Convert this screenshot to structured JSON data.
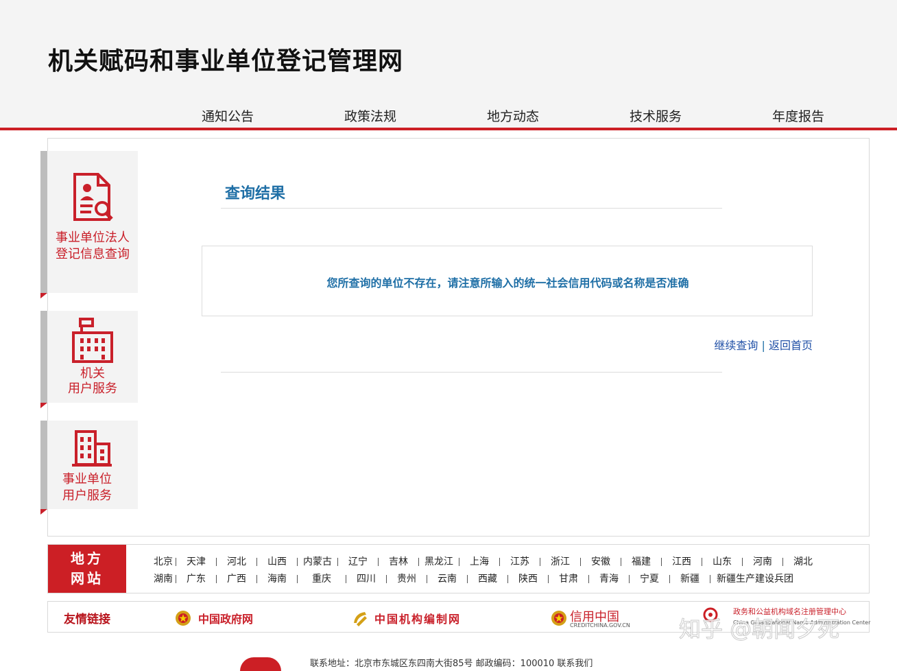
{
  "header": {
    "site_title": "机关赋码和事业单位登记管理网",
    "nav": [
      "通知公告",
      "政策法规",
      "地方动态",
      "技术服务",
      "年度报告"
    ]
  },
  "sidebar": {
    "items": [
      {
        "label_line1": "事业单位法人",
        "label_line2": "登记信息查询",
        "icon": "document-search-icon"
      },
      {
        "label_line1": "机关",
        "label_line2": "用户服务",
        "icon": "government-building-icon"
      },
      {
        "label_line1": "事业单位",
        "label_line2": "用户服务",
        "icon": "office-building-icon"
      }
    ]
  },
  "result": {
    "title": "查询结果",
    "message": "您所查询的单位不存在，请注意所输入的统一社会信用代码或名称是否准确",
    "continue_link": "继续查询",
    "divider": "|",
    "home_link": "返回首页"
  },
  "local_sites": {
    "title_line1": "地方",
    "title_line2": "网站",
    "row1": [
      "北京",
      "天津",
      "河北",
      "山西",
      "内蒙古",
      "辽宁",
      "吉林",
      "黑龙江",
      "上海",
      "江苏",
      "浙江",
      "安徽",
      "福建",
      "江西",
      "山东",
      "河南",
      "湖北"
    ],
    "row2": [
      "湖南",
      "广东",
      "广西",
      "海南",
      "重庆",
      "四川",
      "贵州",
      "云南",
      "西藏",
      "陕西",
      "甘肃",
      "青海",
      "宁夏",
      "新疆",
      "新疆生产建设兵团"
    ]
  },
  "friend_links": {
    "label": "友情链接",
    "items": [
      {
        "text": "中国政府网",
        "icon": "national-emblem-icon"
      },
      {
        "text": "中国机构编制网",
        "icon": "party-emblem-icon"
      },
      {
        "text": "信用中国",
        "sub": "CREDITCHINA.GOV.CN",
        "icon": "national-emblem-icon"
      },
      {
        "text": "政务和公益机构域名注册管理中心",
        "sub": "China Organizational Name Administration Center",
        "icon": "conac-logo-icon"
      }
    ]
  },
  "footer": {
    "contact": "联系地址：北京市东城区东四南大街85号 邮政编码：100010 联系我们"
  },
  "watermark": "知乎 @朝闻夕死",
  "colors": {
    "brand_red": "#cc1f25",
    "link_blue": "#1f6fa6",
    "header_bg": "#f4f4f4"
  }
}
